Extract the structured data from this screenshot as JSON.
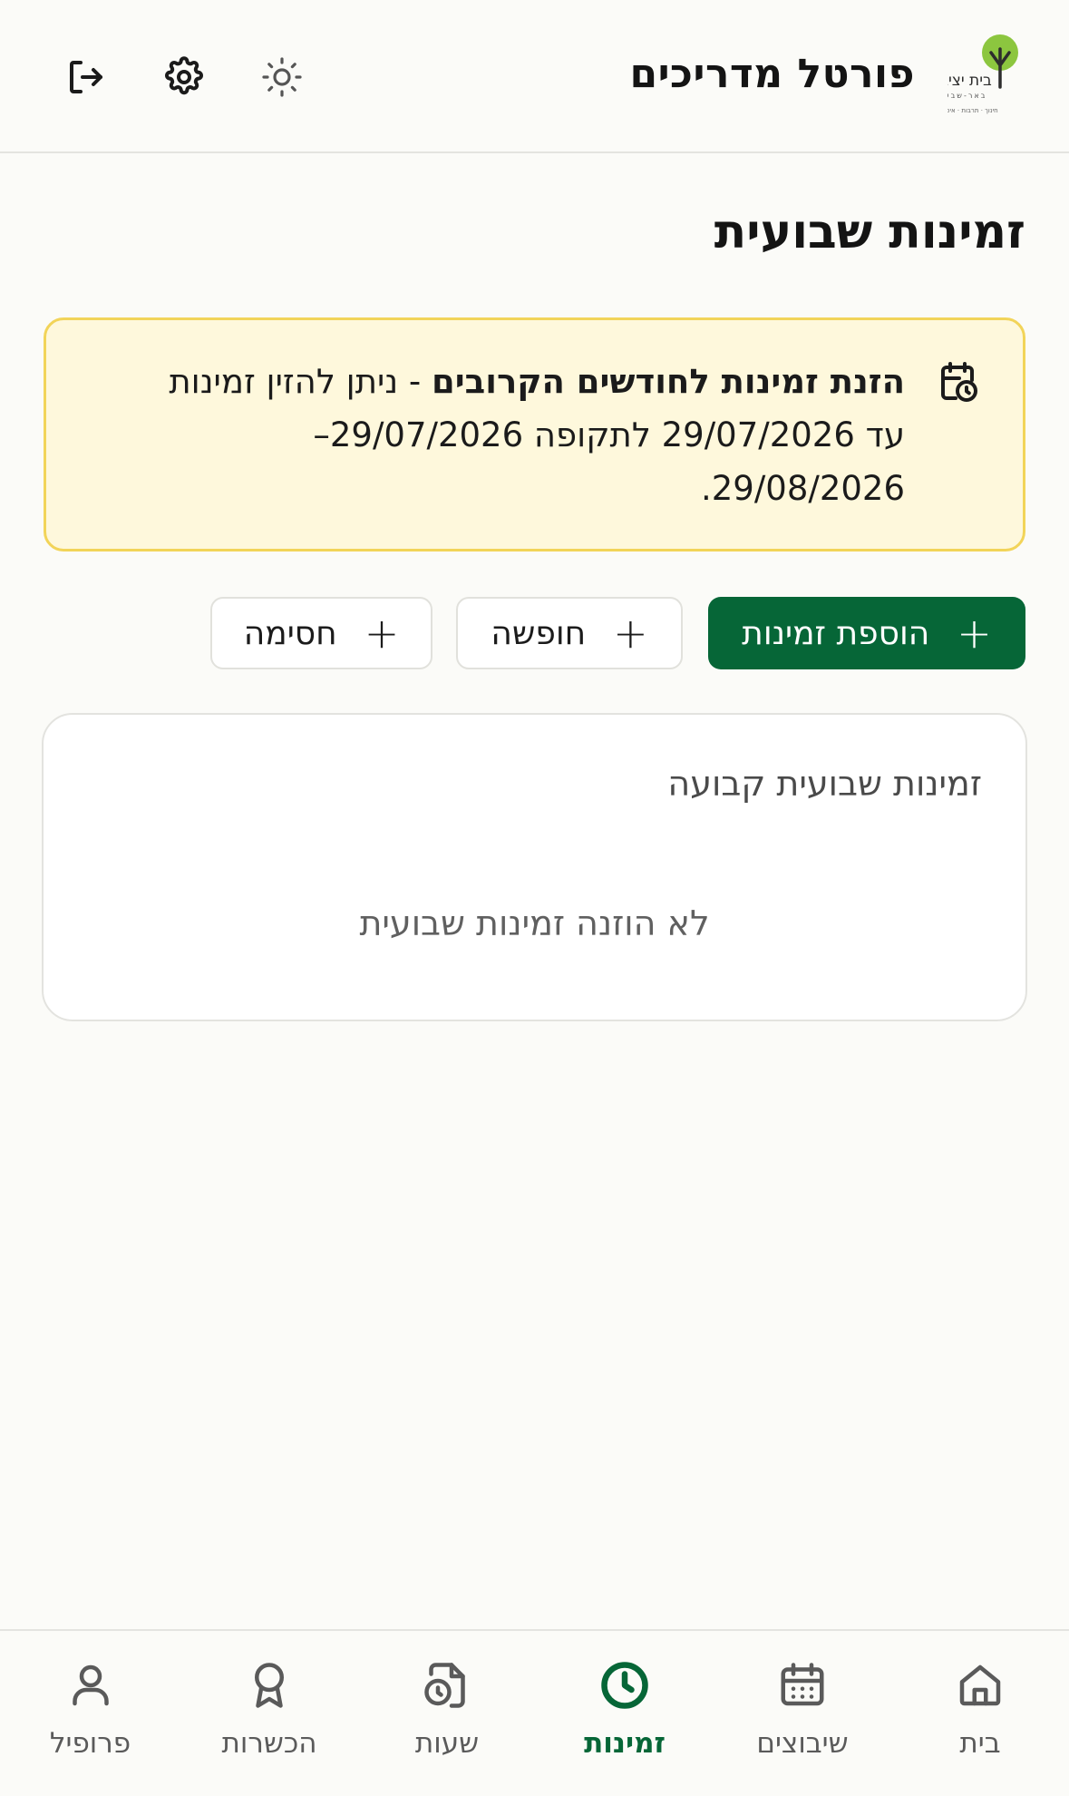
{
  "header": {
    "brand_title": "פורטל מדריכים",
    "logo": {
      "name_line1": "בית יציב",
      "name_line2": "באר-שבע",
      "tagline": "חינוך · תרבות · איכות",
      "leaf_color": "#8cc63f",
      "trunk_color": "#2d2d2d"
    },
    "actions": [
      {
        "icon": "logout-icon"
      },
      {
        "icon": "gear-icon"
      },
      {
        "icon": "sun-icon"
      }
    ]
  },
  "page": {
    "title": "זמינות שבועית"
  },
  "notice": {
    "icon": "calendar-clock-icon",
    "bold_text": "הזנת זמינות לחודשים הקרובים",
    "text": " - ניתן להזין זמינות עד 29/07/2026 לתקופה 29/07/2026–29/08/2026.",
    "background": "#fef8dc",
    "border": "#f2d459"
  },
  "actions": {
    "add_availability": "הוספת זמינות",
    "vacation": "חופשה",
    "block": "חסימה",
    "plus_symbol": "+",
    "primary_color": "#066637"
  },
  "weekly_card": {
    "title": "זמינות שבועית קבועה",
    "empty_text": "לא הוזנה זמינות שבועית"
  },
  "bottom_nav": {
    "active_color": "#066637",
    "items": [
      {
        "label": "בית",
        "icon": "home-icon",
        "active": false
      },
      {
        "label": "שיבוצים",
        "icon": "calendar-icon",
        "active": false
      },
      {
        "label": "זמינות",
        "icon": "clock-icon",
        "active": true
      },
      {
        "label": "שעות",
        "icon": "file-clock-icon",
        "active": false
      },
      {
        "label": "הכשרות",
        "icon": "award-icon",
        "active": false
      },
      {
        "label": "פרופיל",
        "icon": "user-icon",
        "active": false
      }
    ]
  }
}
